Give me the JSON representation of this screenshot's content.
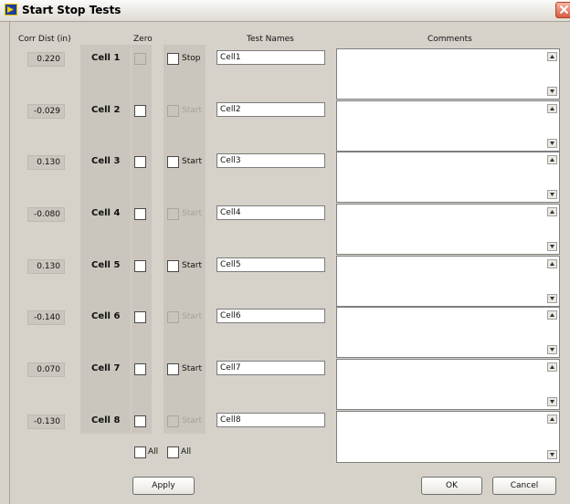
{
  "window": {
    "title": "Start Stop Tests"
  },
  "headers": {
    "corr_dist": "Corr Dist (in)",
    "zero": "Zero",
    "test_names": "Test Names",
    "comments": "Comments"
  },
  "cells": [
    {
      "corr": "0.220",
      "label": "Cell 1",
      "zero_enabled": false,
      "action": "Stop",
      "action_enabled": true,
      "name": "Cell1"
    },
    {
      "corr": "-0.029",
      "label": "Cell 2",
      "zero_enabled": true,
      "action": "Start",
      "action_enabled": false,
      "name": "Cell2"
    },
    {
      "corr": "0.130",
      "label": "Cell 3",
      "zero_enabled": true,
      "action": "Start",
      "action_enabled": true,
      "name": "Cell3"
    },
    {
      "corr": "-0.080",
      "label": "Cell 4",
      "zero_enabled": true,
      "action": "Start",
      "action_enabled": false,
      "name": "Cell4"
    },
    {
      "corr": "0.130",
      "label": "Cell 5",
      "zero_enabled": true,
      "action": "Start",
      "action_enabled": true,
      "name": "Cell5"
    },
    {
      "corr": "-0.140",
      "label": "Cell 6",
      "zero_enabled": true,
      "action": "Start",
      "action_enabled": false,
      "name": "Cell6"
    },
    {
      "corr": "0.070",
      "label": "Cell 7",
      "zero_enabled": true,
      "action": "Start",
      "action_enabled": true,
      "name": "Cell7"
    },
    {
      "corr": "-0.130",
      "label": "Cell 8",
      "zero_enabled": true,
      "action": "Start",
      "action_enabled": false,
      "name": "Cell8"
    }
  ],
  "all_labels": {
    "zero_all": "All",
    "action_all": "All"
  },
  "buttons": {
    "apply": "Apply",
    "ok": "OK",
    "cancel": "Cancel"
  },
  "icons": {
    "app": "labview-vi-icon",
    "close": "close-icon",
    "scroll_up": "scroll-up-icon",
    "scroll_down": "scroll-down-icon"
  },
  "colors": {
    "window_bg": "#d7d3cb",
    "close_button": "#d85b40"
  }
}
